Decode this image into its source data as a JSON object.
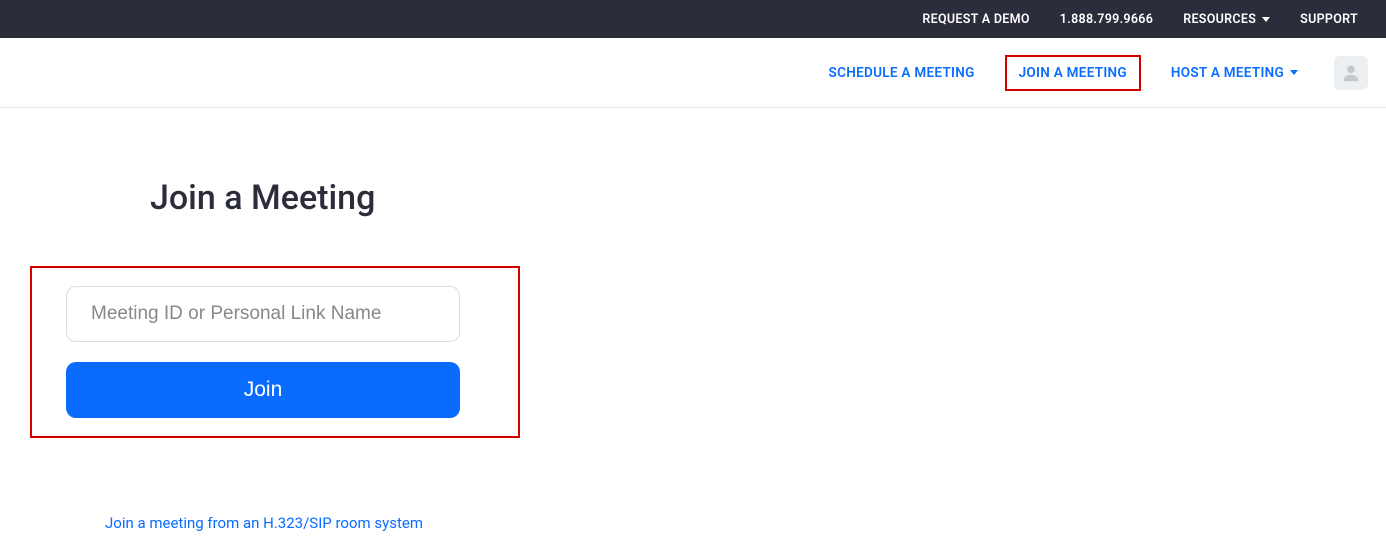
{
  "topbar": {
    "request_demo": "REQUEST A DEMO",
    "phone": "1.888.799.9666",
    "resources": "RESOURCES",
    "support": "SUPPORT"
  },
  "nav": {
    "schedule": "SCHEDULE A MEETING",
    "join": "JOIN A MEETING",
    "host": "HOST A MEETING"
  },
  "main": {
    "title": "Join a Meeting",
    "meeting_id_placeholder": "Meeting ID or Personal Link Name",
    "meeting_id_value": "",
    "join_button": "Join",
    "room_system_link": "Join a meeting from an H.323/SIP room system"
  },
  "colors": {
    "accent": "#0a6cff",
    "highlight": "#d40000",
    "topbar_bg": "#2b2d3a"
  }
}
